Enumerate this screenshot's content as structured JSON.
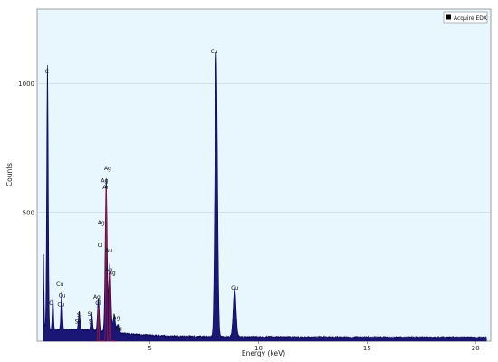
{
  "chart_data": {
    "type": "line",
    "xlabel": "Energy (keV)",
    "ylabel": "Counts",
    "xlim": [
      -0.2,
      20.7
    ],
    "ylim": [
      0,
      1290
    ],
    "x_ticks": [
      "5",
      "10",
      "15",
      "20"
    ],
    "y_ticks": [
      "500",
      "1000"
    ],
    "grid": "horizontal",
    "legend": {
      "position": "top-right",
      "entries": [
        "Acquire EDX"
      ]
    },
    "colors": {
      "plot_bg": "#e8f6fd",
      "fill": "#1a1675",
      "stroke": "#0f0a56",
      "highlight": "#a0143a",
      "legend_marker": "#000000"
    },
    "baseline": 14,
    "peaks": [
      {
        "x": 0.08,
        "y": 420,
        "w": 0.03
      },
      {
        "x": 0.277,
        "y": 1030,
        "w": 0.035
      },
      {
        "x": 0.525,
        "y": 130,
        "w": 0.03
      },
      {
        "x": 0.93,
        "y": 145,
        "w": 0.035
      },
      {
        "x": 1.74,
        "y": 70,
        "w": 0.04
      },
      {
        "x": 2.31,
        "y": 70,
        "w": 0.04
      },
      {
        "x": 2.62,
        "y": 130,
        "w": 0.04
      },
      {
        "x": 2.98,
        "y": 595,
        "w": 0.045
      },
      {
        "x": 3.15,
        "y": 270,
        "w": 0.05
      },
      {
        "x": 3.35,
        "y": 70,
        "w": 0.05
      },
      {
        "x": 3.52,
        "y": 32,
        "w": 0.05
      },
      {
        "x": 8.05,
        "y": 1105,
        "w": 0.06
      },
      {
        "x": 8.9,
        "y": 190,
        "w": 0.065
      }
    ],
    "highlight_peaks": [
      {
        "x": 2.98,
        "y": 595,
        "w": 0.02
      },
      {
        "x": 3.15,
        "y": 270,
        "w": 0.022
      },
      {
        "x": 2.62,
        "y": 130,
        "w": 0.018
      }
    ],
    "annotations": [
      {
        "text": "C",
        "x": 0.25,
        "y": 1040
      },
      {
        "text": "O",
        "x": 0.45,
        "y": 140
      },
      {
        "text": "Cu",
        "x": 0.85,
        "y": 215
      },
      {
        "text": "Cu",
        "x": 0.95,
        "y": 170
      },
      {
        "text": "Cu",
        "x": 0.9,
        "y": 135
      },
      {
        "text": "Si",
        "x": 1.75,
        "y": 95
      },
      {
        "text": "Si",
        "x": 1.65,
        "y": 68
      },
      {
        "text": "S",
        "x": 2.2,
        "y": 98
      },
      {
        "text": "S",
        "x": 2.25,
        "y": 68
      },
      {
        "text": "Ag",
        "x": 2.55,
        "y": 165
      },
      {
        "text": "Cl",
        "x": 2.6,
        "y": 140
      },
      {
        "text": "Ag",
        "x": 3.05,
        "y": 665
      },
      {
        "text": "Ag",
        "x": 2.9,
        "y": 617
      },
      {
        "text": "Ar",
        "x": 2.95,
        "y": 590
      },
      {
        "text": "Ag",
        "x": 2.75,
        "y": 453
      },
      {
        "text": "Cl",
        "x": 2.7,
        "y": 366
      },
      {
        "text": "Au",
        "x": 3.1,
        "y": 347
      },
      {
        "text": "Ag",
        "x": 3.1,
        "y": 270
      },
      {
        "text": "Ag",
        "x": 3.25,
        "y": 258
      },
      {
        "text": "Ag",
        "x": 3.45,
        "y": 85
      },
      {
        "text": "Ag",
        "x": 3.55,
        "y": 42
      },
      {
        "text": "Cu",
        "x": 7.96,
        "y": 1118
      },
      {
        "text": "Cu",
        "x": 8.9,
        "y": 200
      }
    ]
  }
}
